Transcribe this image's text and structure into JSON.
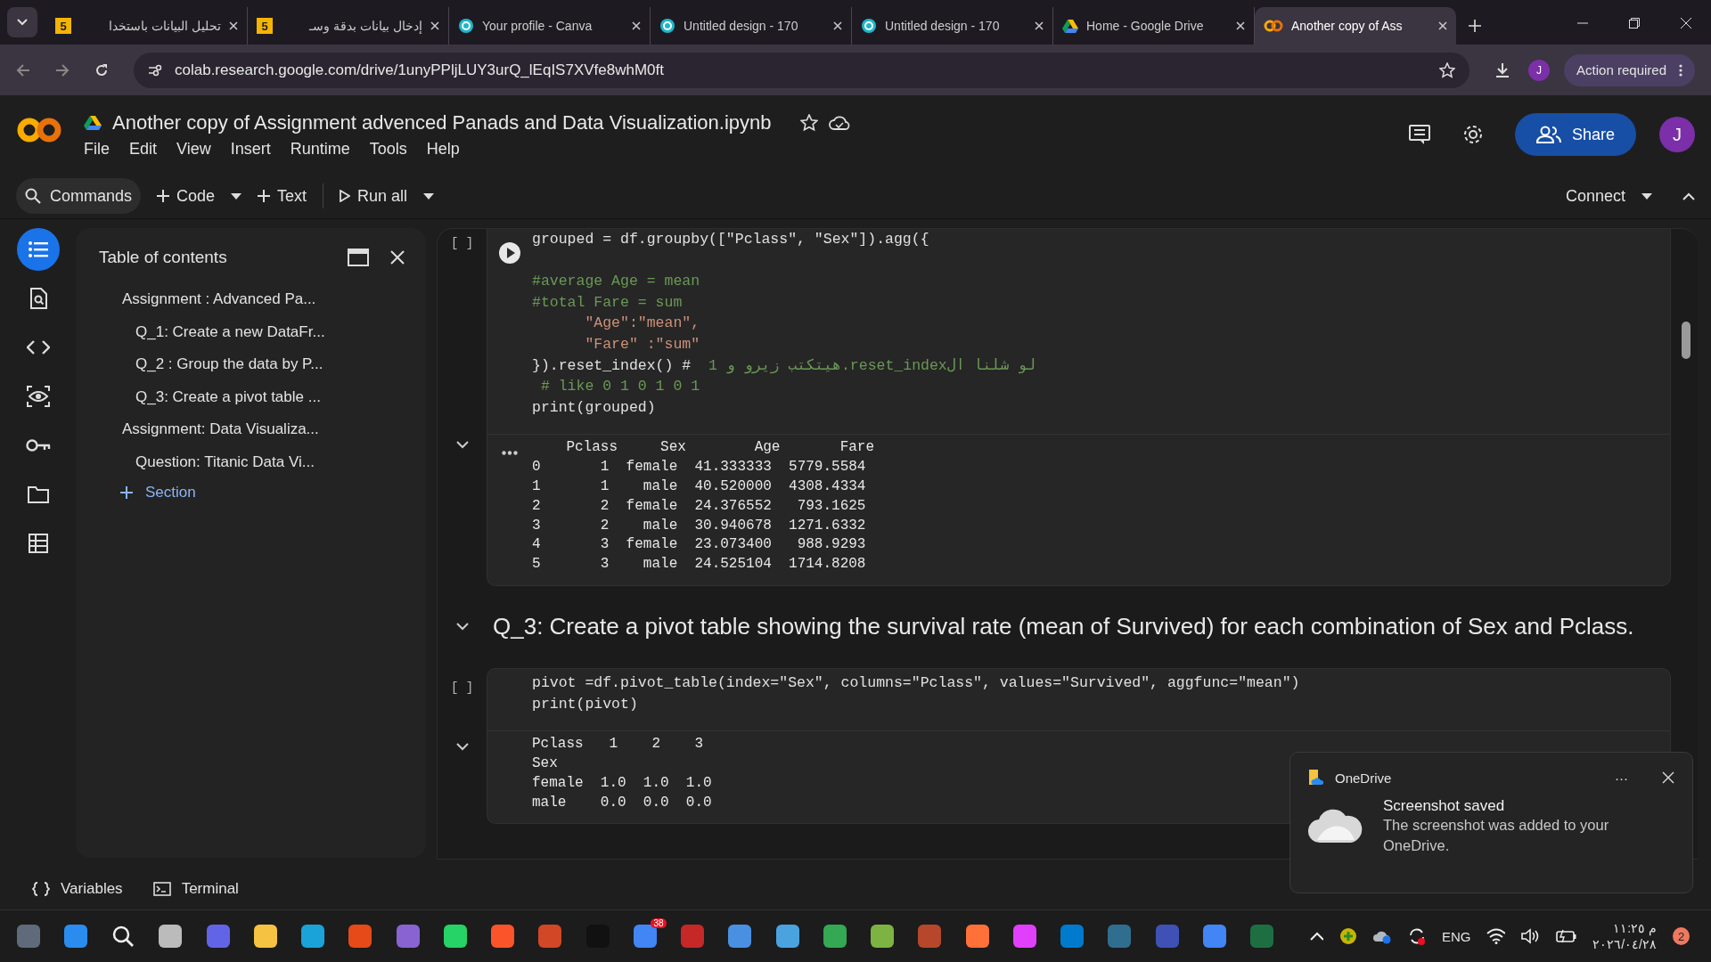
{
  "browser": {
    "tabs": [
      {
        "title": "تحليل البيانات باستخدا",
        "kind": "number",
        "badge": "5",
        "selected": false
      },
      {
        "title": "إدخال بيانات بدقة وسـ",
        "kind": "number",
        "badge": "5",
        "selected": false
      },
      {
        "title": "Your profile - Canva",
        "kind": "circle",
        "selected": false
      },
      {
        "title": "Untitled design - 170",
        "kind": "circle",
        "selected": false
      },
      {
        "title": "Untitled design - 170",
        "kind": "circle",
        "selected": false
      },
      {
        "title": "Home - Google Drive",
        "kind": "drive",
        "selected": false
      },
      {
        "title": "Another copy of Ass",
        "kind": "colab",
        "selected": true
      }
    ],
    "url": "colab.research.google.com/drive/1unyPPljLUY3urQ_lEqIS7XVfe8whM0ft",
    "profile": "J",
    "action": "Action required"
  },
  "colab": {
    "title": "Another copy of Assignment advenced Panads and Data Visualization.ipynb",
    "menu": [
      "File",
      "Edit",
      "View",
      "Insert",
      "Runtime",
      "Tools",
      "Help"
    ],
    "avatar": "J",
    "share": "Share",
    "toolbar": {
      "commands": "Commands",
      "code": "Code",
      "text": "Text",
      "run_all": "Run all",
      "connect": "Connect"
    }
  },
  "rail": [
    {
      "kind": "toc",
      "selected": true
    },
    {
      "kind": "find",
      "selected": false
    },
    {
      "kind": "code",
      "selected": false
    },
    {
      "kind": "eye",
      "selected": false
    },
    {
      "kind": "key",
      "selected": false
    },
    {
      "kind": "folder",
      "selected": false
    },
    {
      "kind": "table",
      "selected": false
    }
  ],
  "toc": {
    "title": "Table of contents",
    "items": [
      {
        "label": "Assignment : Advanced Pa...",
        "children": [
          {
            "label": "Q_1: Create a new DataFr..."
          },
          {
            "label": "Q_2 : Group the data by P..."
          },
          {
            "label": "Q_3: Create a pivot table ..."
          }
        ]
      },
      {
        "label": "Assignment: Data Visualiza...",
        "children": [
          {
            "label": "Question: Titanic Data Vi..."
          }
        ]
      }
    ],
    "add": "Section"
  },
  "cells": [
    {
      "kind": "code",
      "run_marker": "[ ]",
      "run_button": true,
      "lines": [
        {
          "kind": "code",
          "text": "grouped = df.groupby([\"Pclass\", \"Sex\"]).agg({"
        },
        {
          "kind": "comment",
          "text": "#average Age = mean",
          "space_before": true
        },
        {
          "kind": "comment",
          "text": "#total Fare = sum"
        },
        {
          "kind": "string",
          "text": "      \"Age\":\"mean\","
        },
        {
          "kind": "string",
          "text": "      \"Fare\" :\"sum\""
        },
        {
          "kind": "code",
          "text": "}).reset_index() #  ",
          "rtl": "لو شلنا الreset_index.هيتكتب زيرو و 1"
        },
        {
          "kind": "comment",
          "text": " # like 0 1 0 1 0 1"
        },
        {
          "kind": "code",
          "text": "print(grouped)"
        }
      ],
      "output": {
        "more": true,
        "lines": [
          "    Pclass     Sex        Age       Fare",
          "0       1  female  41.333333  5779.5584",
          "1       1    male  40.520000  4308.4334",
          "2       2  female  24.376552   793.1625",
          "3       2    male  30.940678  1271.6332",
          "4       3  female  23.073400   988.9293",
          "5       3    male  24.525104  1714.8208"
        ]
      }
    },
    {
      "kind": "heading",
      "text": "Q_3: Create a pivot table showing the survival rate (mean of Survived) for each combination of Sex and Pclass."
    },
    {
      "kind": "code",
      "run_marker": "[ ]",
      "run_button": false,
      "lines": [
        {
          "kind": "code",
          "text": "pivot =df.pivot_table(index=\"Sex\", columns=\"Pclass\", values=\"Survived\", aggfunc=\"mean\")"
        },
        {
          "kind": "code",
          "text": "print(pivot)"
        }
      ],
      "output": {
        "more": false,
        "lines": [
          "Pclass   1    2    3",
          "Sex",
          "female  1.0  1.0  1.0",
          "male    0.0  0.0  0.0"
        ]
      }
    }
  ],
  "bottom": {
    "variables": "Variables",
    "terminal": "Terminal"
  },
  "toast": {
    "app": "OneDrive",
    "menu": "···",
    "title": "Screenshot saved",
    "body": "The screenshot was added to your OneDrive."
  },
  "taskbar": {
    "mail_badge": "38",
    "language": "ENG",
    "time": "م ١١:٢٥",
    "date": "٢٠٢٦/٠٤/٢٨",
    "notifications": "2"
  }
}
